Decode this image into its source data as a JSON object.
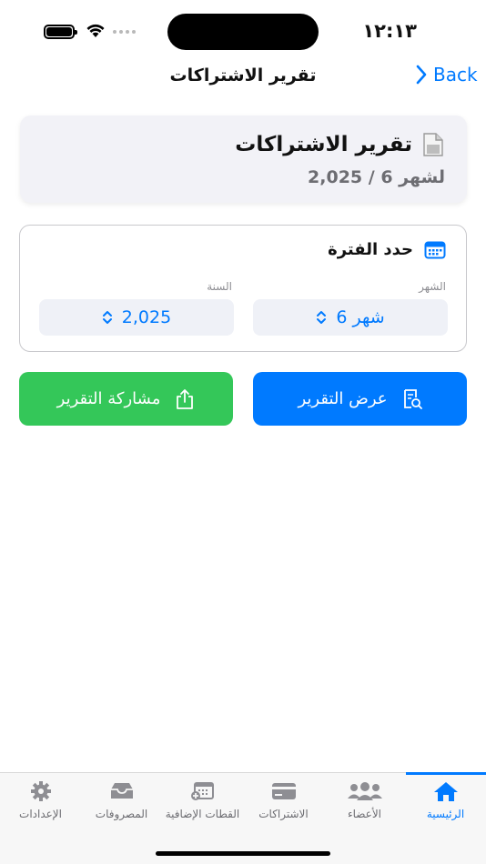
{
  "status_bar": {
    "time": "١٢:١٣"
  },
  "nav": {
    "title": "تقرير الاشتراكات",
    "back_label": "Back"
  },
  "header": {
    "title": "تقرير الاشتراكات",
    "subtitle": "لشهر 6 / 2,025",
    "icon": "document-icon"
  },
  "period": {
    "title": "حدد الفترة",
    "icon": "calendar-icon",
    "month_label": "الشهر",
    "month_value": "شهر 6",
    "year_label": "السنة",
    "year_value": "2,025"
  },
  "actions": {
    "view_label": "عرض التقرير",
    "share_label": "مشاركة التقرير"
  },
  "tabs": [
    {
      "label": "الرئيسية",
      "icon": "home-icon",
      "active": true
    },
    {
      "label": "الأعضاء",
      "icon": "members-icon",
      "active": false
    },
    {
      "label": "الاشتراكات",
      "icon": "card-icon",
      "active": false
    },
    {
      "label": "القطات الإضافية",
      "icon": "calendar-add-icon",
      "active": false
    },
    {
      "label": "المصروفات",
      "icon": "tray-icon",
      "active": false
    },
    {
      "label": "الإعدادات",
      "icon": "gear-icon",
      "active": false
    }
  ],
  "colors": {
    "accent": "#007aff",
    "share": "#34c759",
    "card_bg": "#f2f2f7",
    "picker_bg": "#eff1f7"
  }
}
